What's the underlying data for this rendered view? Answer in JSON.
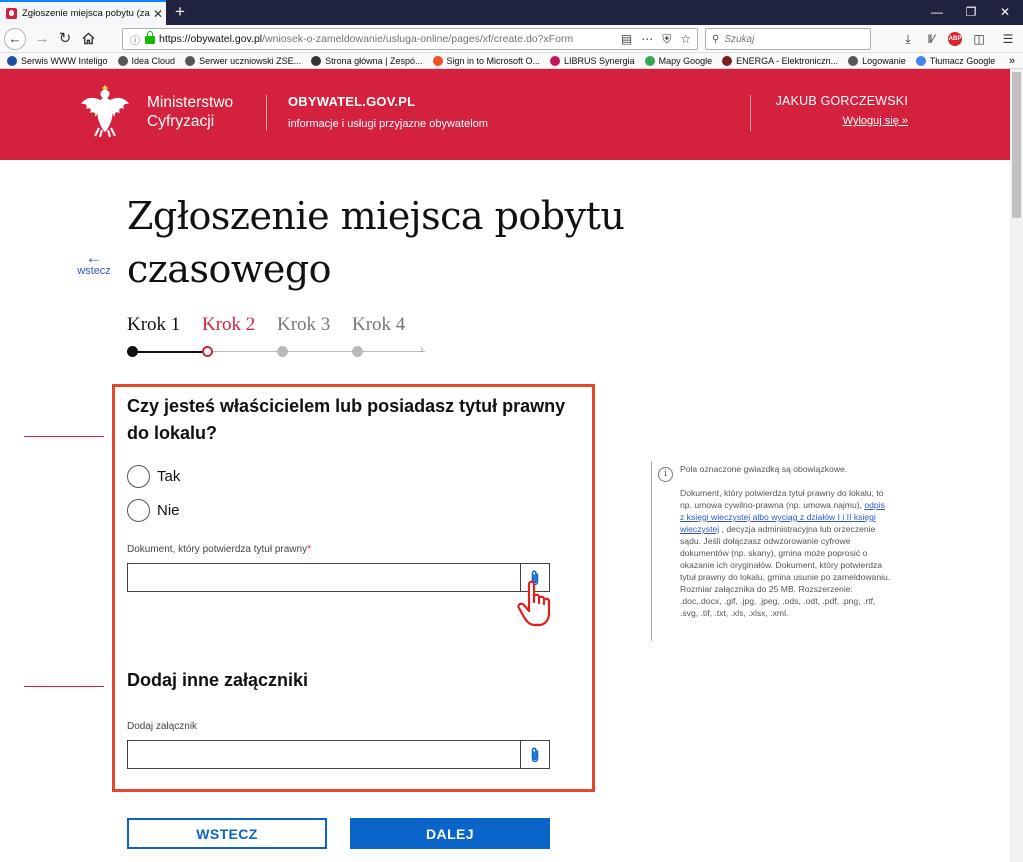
{
  "browser": {
    "tab_title": "Zgłoszenie miejsca pobytu (zam",
    "tab_close": "✕",
    "new_tab": "+",
    "url_host": "https://obywatel.gov.pl",
    "url_path": "/wniosek-o-zameldowanie/usluga-online/pages/xf/create.do?xForm",
    "search_placeholder": "Szukaj",
    "icons": {
      "back": "arrow-left-icon",
      "forward": "arrow-right-icon",
      "reload": "reload-icon",
      "home": "home-icon",
      "info": "info-icon",
      "lock": "lock-icon",
      "reader": "reader-view-icon",
      "more": "more-icon",
      "pocket": "pocket-icon",
      "bookmark": "star-icon",
      "downloads": "download-icon",
      "library": "library-icon",
      "adblock": "adblock-icon",
      "sidebar": "sidebar-icon",
      "menu": "hamburger-menu-icon"
    },
    "adblock_label": "ABP"
  },
  "bookmarks": [
    {
      "label": "Serwis WWW Inteligo",
      "color": "#1c4ea0"
    },
    {
      "label": "Idea Cloud",
      "color": "#555555"
    },
    {
      "label": "Serwer uczniowski ZSE...",
      "color": "#555555"
    },
    {
      "label": "Strona główna | Zespó...",
      "color": "#333333"
    },
    {
      "label": "Sign in to Microsoft O...",
      "color": "#f25022"
    },
    {
      "label": "LIBRUS Synergia",
      "color": "#c2185b"
    },
    {
      "label": "Mapy Google",
      "color": "#34a853"
    },
    {
      "label": "ENERGA - Elektroniczn...",
      "color": "#7a1f1f"
    },
    {
      "label": "Logowanie",
      "color": "#555555"
    },
    {
      "label": "Tłumacz Google",
      "color": "#4285f4"
    }
  ],
  "bookmarks_more": "»",
  "header": {
    "ministry_line1": "Ministerstwo",
    "ministry_line2": "Cyfryzacji",
    "portal_name": "OBYWATEL.GOV.PL",
    "portal_tagline": "informacje i usługi przyjazne obywatelom",
    "user_name": "JAKUB GORCZEWSKI",
    "logout": "Wyloguj się »",
    "brand_color": "#d4213d"
  },
  "page": {
    "back_label": "wstecz",
    "back_arrow": "←",
    "title": "Zgłoszenie miejsca pobytu czasowego",
    "steps": [
      "Krok 1",
      "Krok 2",
      "Krok 3",
      "Krok 4"
    ],
    "current_step": 2
  },
  "form": {
    "question": "Czy jesteś właścicielem lub posiadasz tytuł prawny do lokalu?",
    "option_yes": "Tak",
    "option_no": "Nie",
    "doc_label": "Dokument, który potwierdza tytuł prawny",
    "required_mark": "*",
    "attachments_section": "Dodaj inne załączniki",
    "attachment_label": "Dodaj załącznik",
    "doc_value": "",
    "attachment_value": ""
  },
  "info": {
    "icon": "i",
    "required_note": "Pola oznaczone gwiazdką są obowiązkowe.",
    "text_before_link": "Dokument, który potwierdza tytuł prawny do lokalu, to np. umowa cywilno-prawna (np. umowa najmu), ",
    "link_text": "odpis z księgi wieczystej albo wyciąg z działów I i II księgi wieczystej",
    "text_after_link": " , decyzja administracyjna lub orzeczenie sądu. Jeśli dołączasz odwzorowanie cyfrowe dokumentów (np. skany), gmina może poprosić o okazanie ich oryginałów. Dokument, który potwierdza tytuł prawny do lokalu, gmina usunie po zameldowaniu. Rozmiar załącznika do 25 MB. Rozszerzenie: .doc,.docx, .gif, .jpg, .jpeg, .ods, .odt, .pdf, .png, .rtf, .svg, .tif, .txt, .xls, .xlsx, .xml."
  },
  "buttons": {
    "back": "WSTECZ",
    "next": "DALEJ"
  },
  "colors": {
    "accent_blue": "#0a64c9",
    "highlight_box": "#e04a2f"
  }
}
